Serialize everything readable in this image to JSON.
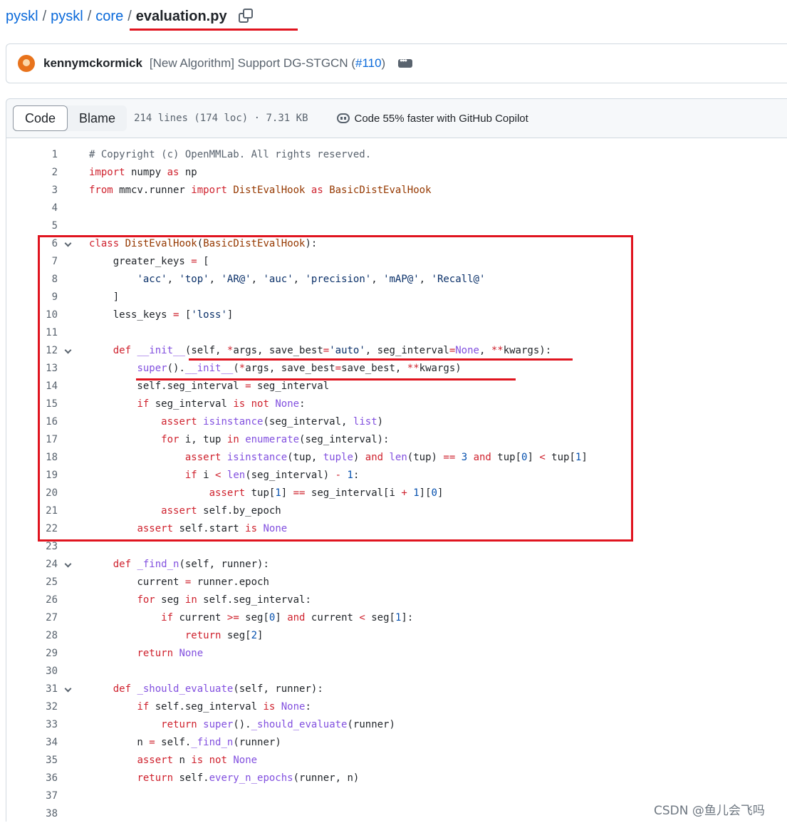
{
  "breadcrumb": {
    "items": [
      "pyskl",
      "pyskl",
      "core"
    ],
    "separator": "/",
    "current": "evaluation.py"
  },
  "commit": {
    "author": "kennymckormick",
    "message_prefix": "[New Algorithm] Support DG-STGCN (",
    "pr_link": "#110",
    "message_suffix": ")"
  },
  "file_header": {
    "tabs": [
      "Code",
      "Blame"
    ],
    "active_tab": "Code",
    "stats": "214 lines (174 loc) · 7.31 KB",
    "copilot": "Code 55% faster with GitHub Copilot"
  },
  "code_lines": [
    {
      "n": "1",
      "code": "# Copyright (c) OpenMMLab. All rights reserved."
    },
    {
      "n": "2",
      "code": "import numpy as np"
    },
    {
      "n": "3",
      "code": "from mmcv.runner import DistEvalHook as BasicDistEvalHook"
    },
    {
      "n": "4",
      "code": ""
    },
    {
      "n": "5",
      "code": ""
    },
    {
      "n": "6",
      "code": "class DistEvalHook(BasicDistEvalHook):",
      "fold": true
    },
    {
      "n": "7",
      "code": "    greater_keys = ["
    },
    {
      "n": "8",
      "code": "        'acc', 'top', 'AR@', 'auc', 'precision', 'mAP@', 'Recall@'"
    },
    {
      "n": "9",
      "code": "    ]"
    },
    {
      "n": "10",
      "code": "    less_keys = ['loss']"
    },
    {
      "n": "11",
      "code": ""
    },
    {
      "n": "12",
      "code": "    def __init__(self, *args, save_best='auto', seg_interval=None, **kwargs):",
      "fold": true
    },
    {
      "n": "13",
      "code": "        super().__init__(*args, save_best=save_best, **kwargs)"
    },
    {
      "n": "14",
      "code": "        self.seg_interval = seg_interval"
    },
    {
      "n": "15",
      "code": "        if seg_interval is not None:"
    },
    {
      "n": "16",
      "code": "            assert isinstance(seg_interval, list)"
    },
    {
      "n": "17",
      "code": "            for i, tup in enumerate(seg_interval):"
    },
    {
      "n": "18",
      "code": "                assert isinstance(tup, tuple) and len(tup) == 3 and tup[0] < tup[1]"
    },
    {
      "n": "19",
      "code": "                if i < len(seg_interval) - 1:"
    },
    {
      "n": "20",
      "code": "                    assert tup[1] == seg_interval[i + 1][0]"
    },
    {
      "n": "21",
      "code": "            assert self.by_epoch"
    },
    {
      "n": "22",
      "code": "        assert self.start is None"
    },
    {
      "n": "23",
      "code": ""
    },
    {
      "n": "24",
      "code": "    def _find_n(self, runner):",
      "fold": true
    },
    {
      "n": "25",
      "code": "        current = runner.epoch"
    },
    {
      "n": "26",
      "code": "        for seg in self.seg_interval:"
    },
    {
      "n": "27",
      "code": "            if current >= seg[0] and current < seg[1]:"
    },
    {
      "n": "28",
      "code": "                return seg[2]"
    },
    {
      "n": "29",
      "code": "        return None"
    },
    {
      "n": "30",
      "code": ""
    },
    {
      "n": "31",
      "code": "    def _should_evaluate(self, runner):",
      "fold": true
    },
    {
      "n": "32",
      "code": "        if self.seg_interval is None:"
    },
    {
      "n": "33",
      "code": "            return super()._should_evaluate(runner)"
    },
    {
      "n": "34",
      "code": "        n = self._find_n(runner)"
    },
    {
      "n": "35",
      "code": "        assert n is not None"
    },
    {
      "n": "36",
      "code": "        return self.every_n_epochs(runner, n)"
    },
    {
      "n": "37",
      "code": ""
    },
    {
      "n": "38",
      "code": ""
    }
  ],
  "watermark": "CSDN @鱼儿会飞吗",
  "colors": {
    "link": "#0969da",
    "keyword": "#cf222e",
    "classname": "#953800",
    "string": "#0a3069",
    "builtin": "#8250df",
    "annotation": "#e0141f"
  }
}
